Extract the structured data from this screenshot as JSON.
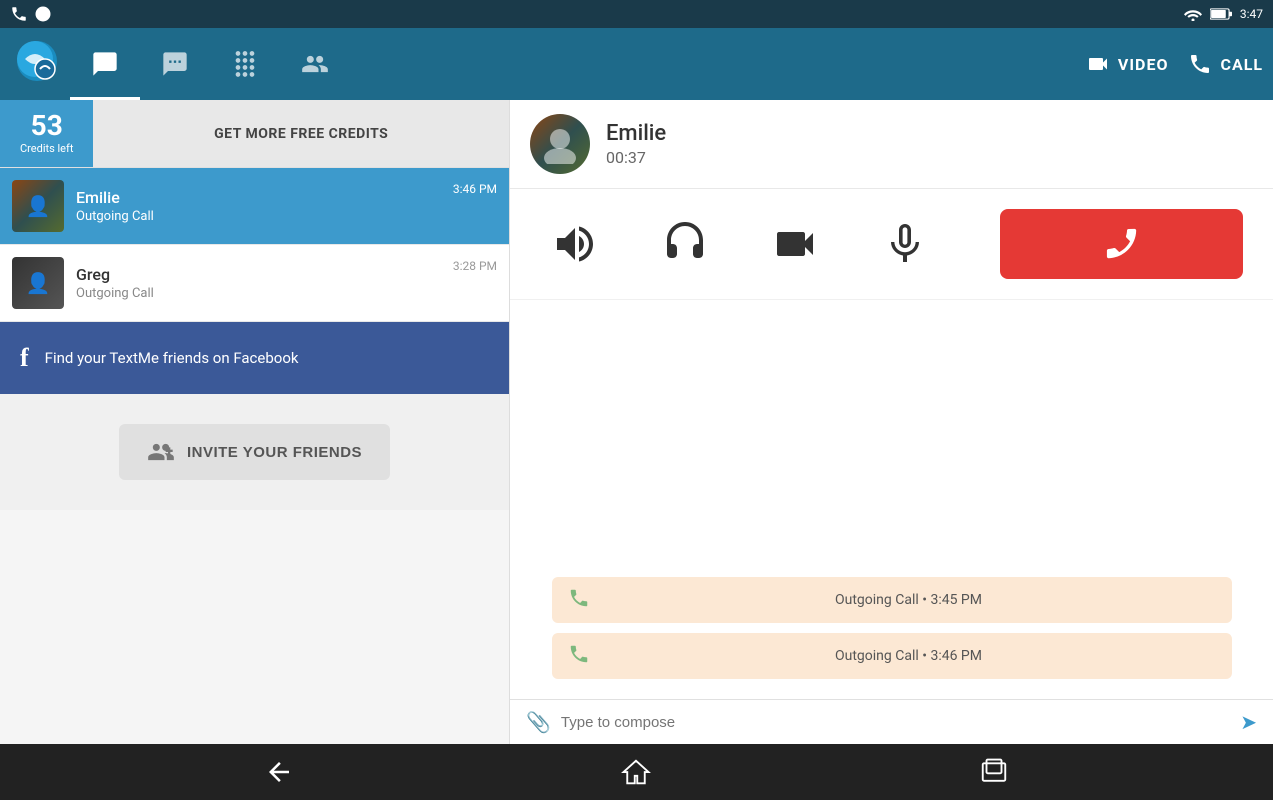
{
  "statusBar": {
    "time": "3:47",
    "icons": [
      "phone",
      "viber",
      "wifi",
      "battery"
    ]
  },
  "navBar": {
    "tabs": [
      {
        "id": "messages",
        "label": "Messages",
        "active": true
      },
      {
        "id": "chat",
        "label": "Chat"
      },
      {
        "id": "dialpad",
        "label": "Dialpad"
      },
      {
        "id": "contacts",
        "label": "Contacts"
      }
    ],
    "actions": [
      {
        "id": "video",
        "label": "VIDEO"
      },
      {
        "id": "call",
        "label": "CALL"
      }
    ]
  },
  "creditsBar": {
    "count": "53",
    "countLabel": "Credits left",
    "btnLabel": "GET MORE FREE CREDITS"
  },
  "contacts": [
    {
      "id": "emilie",
      "name": "Emilie",
      "sub": "Outgoing Call",
      "time": "3:46 PM",
      "active": true
    },
    {
      "id": "greg",
      "name": "Greg",
      "sub": "Outgoing Call",
      "time": "3:28 PM",
      "active": false
    }
  ],
  "facebookBanner": {
    "icon": "f",
    "text": "Find your TextMe friends on Facebook"
  },
  "inviteBtn": {
    "label": "INVITE YOUR FRIENDS"
  },
  "callPanel": {
    "contactName": "Emilie",
    "timer": "00:37",
    "controls": [
      {
        "id": "speaker",
        "label": "Speaker"
      },
      {
        "id": "headset",
        "label": "Headset"
      },
      {
        "id": "video",
        "label": "Video"
      },
      {
        "id": "mute",
        "label": "Mute"
      }
    ],
    "endCallLabel": "End Call"
  },
  "chatItems": [
    {
      "text": "Outgoing Call • 3:45 PM",
      "type": "call"
    },
    {
      "text": "Outgoing Call • 3:46 PM",
      "type": "call"
    }
  ],
  "composePlaceholder": "Type to compose",
  "bottomNav": {
    "buttons": [
      "back",
      "home",
      "recents"
    ]
  }
}
